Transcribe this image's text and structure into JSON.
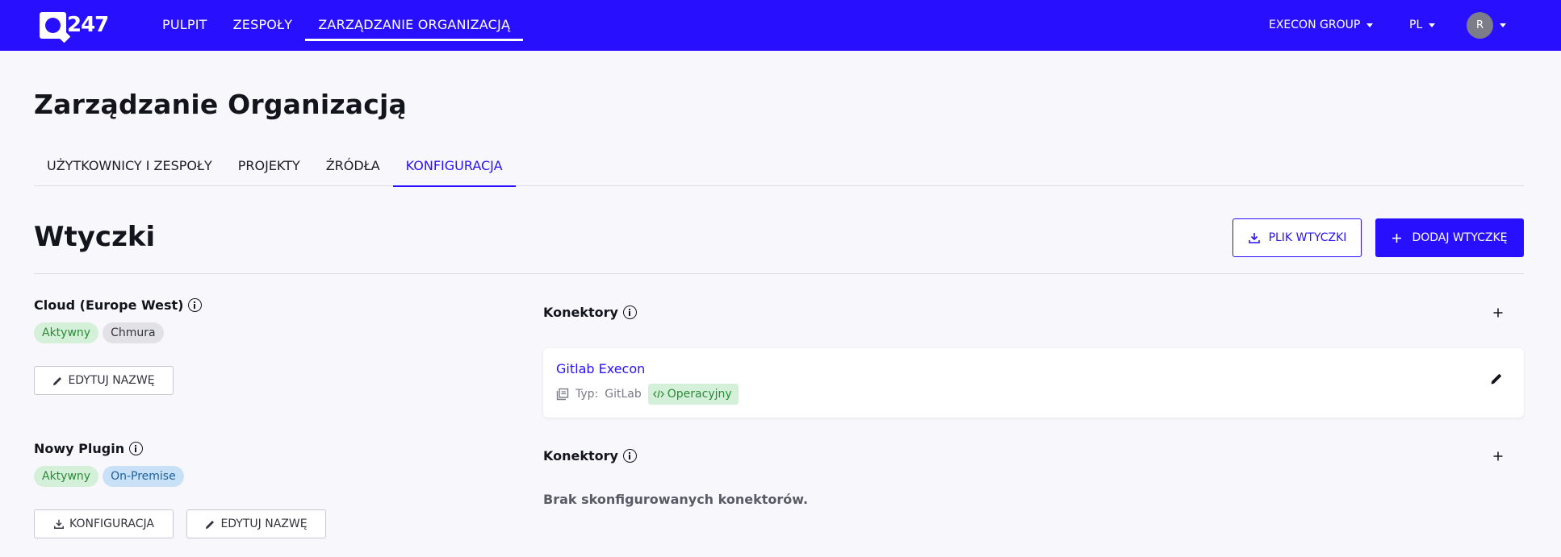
{
  "header": {
    "logo_text": "247",
    "nav": [
      "PULPIT",
      "ZESPOŁY",
      "ZARZĄDZANIE ORGANIZACJĄ"
    ],
    "org": "EXECON GROUP",
    "lang": "PL",
    "avatar": "R"
  },
  "page": {
    "title": "Zarządzanie Organizacją",
    "tabs": [
      "UŻYTKOWNICY I ZESPOŁY",
      "PROJEKTY",
      "ŹRÓDŁA",
      "KONFIGURACJA"
    ]
  },
  "plugins_section": {
    "title": "Wtyczki",
    "file_button": "PLIK WTYCZKI",
    "add_button": "DODAJ WTYCZKĘ"
  },
  "plugins": [
    {
      "name": "Cloud (Europe West)",
      "status": "Aktywny",
      "type": "Chmura",
      "edit_label": "EDYTUJ NAZWĘ",
      "connectors_title": "Konektory",
      "connector": {
        "name": "Gitlab Execon",
        "type_label": "Typ:",
        "type_value": "GitLab",
        "mode": "Operacyjny"
      }
    },
    {
      "name": "Nowy Plugin",
      "status": "Aktywny",
      "type": "On-Premise",
      "config_label": "KONFIGURACJA",
      "edit_label": "EDYTUJ NAZWĘ",
      "connectors_title": "Konektory",
      "empty_text": "Brak skonfigurowanych konektorów."
    }
  ],
  "colors": {
    "brand": "#2810ff",
    "success_bg": "#d5f0d8",
    "success_fg": "#2a8a3a",
    "info_bg": "#c8e1f6"
  }
}
